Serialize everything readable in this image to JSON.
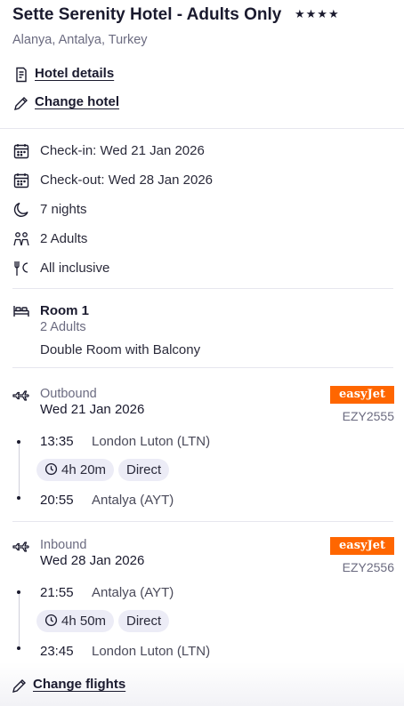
{
  "hotel": {
    "name": "Sette Serenity Hotel - Adults Only",
    "stars": "★★★★",
    "location": "Alanya, Antalya, Turkey",
    "details_link": "Hotel details",
    "change_link": "Change hotel"
  },
  "stay": {
    "checkin": "Check-in: Wed 21 Jan 2026",
    "checkout": "Check-out: Wed 28 Jan 2026",
    "nights": "7 nights",
    "guests": "2 Adults",
    "board": "All inclusive"
  },
  "room": {
    "title": "Room 1",
    "guests": "2 Adults",
    "type": "Double Room with Balcony"
  },
  "outbound": {
    "label": "Outbound",
    "date": "Wed 21 Jan 2026",
    "airline": "easyJet",
    "flight_no": "EZY2555",
    "depart_time": "13:35",
    "depart_airport": "London Luton (LTN)",
    "duration": "4h 20m",
    "stops": "Direct",
    "arrive_time": "20:55",
    "arrive_airport": "Antalya (AYT)"
  },
  "inbound": {
    "label": "Inbound",
    "date": "Wed 28 Jan 2026",
    "airline": "easyJet",
    "flight_no": "EZY2556",
    "depart_time": "21:55",
    "depart_airport": "Antalya (AYT)",
    "duration": "4h 50m",
    "stops": "Direct",
    "arrive_time": "23:45",
    "arrive_airport": "London Luton (LTN)"
  },
  "footer": {
    "change_flights": "Change flights"
  },
  "colors": {
    "airline_brand": "#ff6600",
    "pill_bg": "#ececf6",
    "text_primary": "#1a1a2e",
    "text_muted": "#6b6b80"
  },
  "icons": {
    "details": "document-icon",
    "edit": "pencil-icon",
    "calendar": "calendar-icon",
    "nights": "moon-icon",
    "guests": "people-icon",
    "board": "cutlery-icon",
    "room": "bed-icon",
    "outbound": "plane-takeoff-icon",
    "inbound": "plane-landing-icon",
    "duration": "clock-icon"
  }
}
